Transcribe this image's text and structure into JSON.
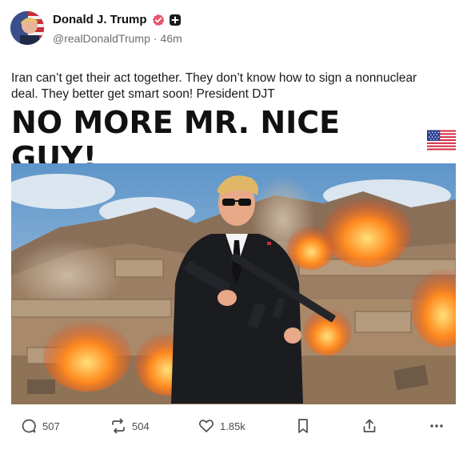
{
  "author": {
    "name": "Donald J. Trump",
    "handle": "@realDonaldTrump",
    "separator": "·",
    "time": "46m"
  },
  "post": {
    "text": "Iran can’t get their act together. They don’t know how to sign a nonnuclear deal. They better get smart soon! President DJT"
  },
  "media": {
    "headline": "NO MORE MR. NICE GUY!",
    "flag_icon": "us-flag-icon",
    "image": "man-in-suit-with-rifle-explosions"
  },
  "actions": {
    "replies": "507",
    "reposts": "504",
    "likes": "1.85k"
  },
  "colors": {
    "verified": "#e8566c",
    "text": "#1a1a1a",
    "muted": "#6b6f75"
  }
}
